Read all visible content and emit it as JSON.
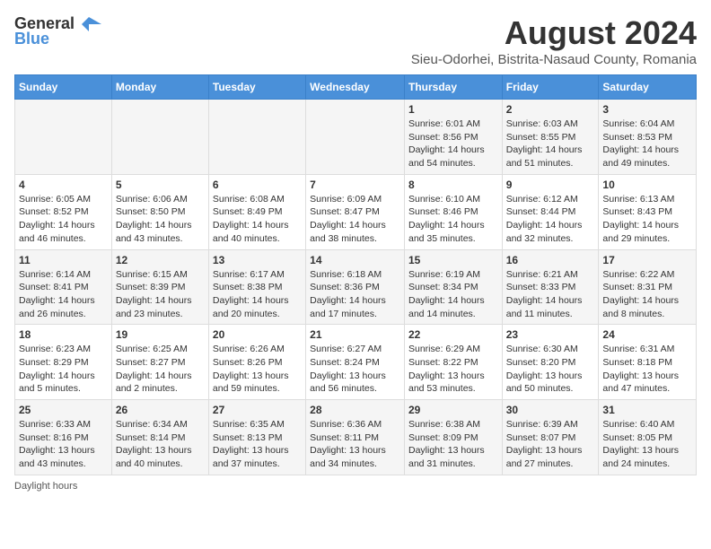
{
  "header": {
    "logo_general": "General",
    "logo_blue": "Blue",
    "title": "August 2024",
    "subtitle": "Sieu-Odorhei, Bistrita-Nasaud County, Romania"
  },
  "calendar": {
    "days_of_week": [
      "Sunday",
      "Monday",
      "Tuesday",
      "Wednesday",
      "Thursday",
      "Friday",
      "Saturday"
    ],
    "weeks": [
      [
        {
          "day": "",
          "info": ""
        },
        {
          "day": "",
          "info": ""
        },
        {
          "day": "",
          "info": ""
        },
        {
          "day": "",
          "info": ""
        },
        {
          "day": "1",
          "info": "Sunrise: 6:01 AM\nSunset: 8:56 PM\nDaylight: 14 hours and 54 minutes."
        },
        {
          "day": "2",
          "info": "Sunrise: 6:03 AM\nSunset: 8:55 PM\nDaylight: 14 hours and 51 minutes."
        },
        {
          "day": "3",
          "info": "Sunrise: 6:04 AM\nSunset: 8:53 PM\nDaylight: 14 hours and 49 minutes."
        }
      ],
      [
        {
          "day": "4",
          "info": "Sunrise: 6:05 AM\nSunset: 8:52 PM\nDaylight: 14 hours and 46 minutes."
        },
        {
          "day": "5",
          "info": "Sunrise: 6:06 AM\nSunset: 8:50 PM\nDaylight: 14 hours and 43 minutes."
        },
        {
          "day": "6",
          "info": "Sunrise: 6:08 AM\nSunset: 8:49 PM\nDaylight: 14 hours and 40 minutes."
        },
        {
          "day": "7",
          "info": "Sunrise: 6:09 AM\nSunset: 8:47 PM\nDaylight: 14 hours and 38 minutes."
        },
        {
          "day": "8",
          "info": "Sunrise: 6:10 AM\nSunset: 8:46 PM\nDaylight: 14 hours and 35 minutes."
        },
        {
          "day": "9",
          "info": "Sunrise: 6:12 AM\nSunset: 8:44 PM\nDaylight: 14 hours and 32 minutes."
        },
        {
          "day": "10",
          "info": "Sunrise: 6:13 AM\nSunset: 8:43 PM\nDaylight: 14 hours and 29 minutes."
        }
      ],
      [
        {
          "day": "11",
          "info": "Sunrise: 6:14 AM\nSunset: 8:41 PM\nDaylight: 14 hours and 26 minutes."
        },
        {
          "day": "12",
          "info": "Sunrise: 6:15 AM\nSunset: 8:39 PM\nDaylight: 14 hours and 23 minutes."
        },
        {
          "day": "13",
          "info": "Sunrise: 6:17 AM\nSunset: 8:38 PM\nDaylight: 14 hours and 20 minutes."
        },
        {
          "day": "14",
          "info": "Sunrise: 6:18 AM\nSunset: 8:36 PM\nDaylight: 14 hours and 17 minutes."
        },
        {
          "day": "15",
          "info": "Sunrise: 6:19 AM\nSunset: 8:34 PM\nDaylight: 14 hours and 14 minutes."
        },
        {
          "day": "16",
          "info": "Sunrise: 6:21 AM\nSunset: 8:33 PM\nDaylight: 14 hours and 11 minutes."
        },
        {
          "day": "17",
          "info": "Sunrise: 6:22 AM\nSunset: 8:31 PM\nDaylight: 14 hours and 8 minutes."
        }
      ],
      [
        {
          "day": "18",
          "info": "Sunrise: 6:23 AM\nSunset: 8:29 PM\nDaylight: 14 hours and 5 minutes."
        },
        {
          "day": "19",
          "info": "Sunrise: 6:25 AM\nSunset: 8:27 PM\nDaylight: 14 hours and 2 minutes."
        },
        {
          "day": "20",
          "info": "Sunrise: 6:26 AM\nSunset: 8:26 PM\nDaylight: 13 hours and 59 minutes."
        },
        {
          "day": "21",
          "info": "Sunrise: 6:27 AM\nSunset: 8:24 PM\nDaylight: 13 hours and 56 minutes."
        },
        {
          "day": "22",
          "info": "Sunrise: 6:29 AM\nSunset: 8:22 PM\nDaylight: 13 hours and 53 minutes."
        },
        {
          "day": "23",
          "info": "Sunrise: 6:30 AM\nSunset: 8:20 PM\nDaylight: 13 hours and 50 minutes."
        },
        {
          "day": "24",
          "info": "Sunrise: 6:31 AM\nSunset: 8:18 PM\nDaylight: 13 hours and 47 minutes."
        }
      ],
      [
        {
          "day": "25",
          "info": "Sunrise: 6:33 AM\nSunset: 8:16 PM\nDaylight: 13 hours and 43 minutes."
        },
        {
          "day": "26",
          "info": "Sunrise: 6:34 AM\nSunset: 8:14 PM\nDaylight: 13 hours and 40 minutes."
        },
        {
          "day": "27",
          "info": "Sunrise: 6:35 AM\nSunset: 8:13 PM\nDaylight: 13 hours and 37 minutes."
        },
        {
          "day": "28",
          "info": "Sunrise: 6:36 AM\nSunset: 8:11 PM\nDaylight: 13 hours and 34 minutes."
        },
        {
          "day": "29",
          "info": "Sunrise: 6:38 AM\nSunset: 8:09 PM\nDaylight: 13 hours and 31 minutes."
        },
        {
          "day": "30",
          "info": "Sunrise: 6:39 AM\nSunset: 8:07 PM\nDaylight: 13 hours and 27 minutes."
        },
        {
          "day": "31",
          "info": "Sunrise: 6:40 AM\nSunset: 8:05 PM\nDaylight: 13 hours and 24 minutes."
        }
      ]
    ]
  },
  "footer": {
    "note": "Daylight hours"
  }
}
